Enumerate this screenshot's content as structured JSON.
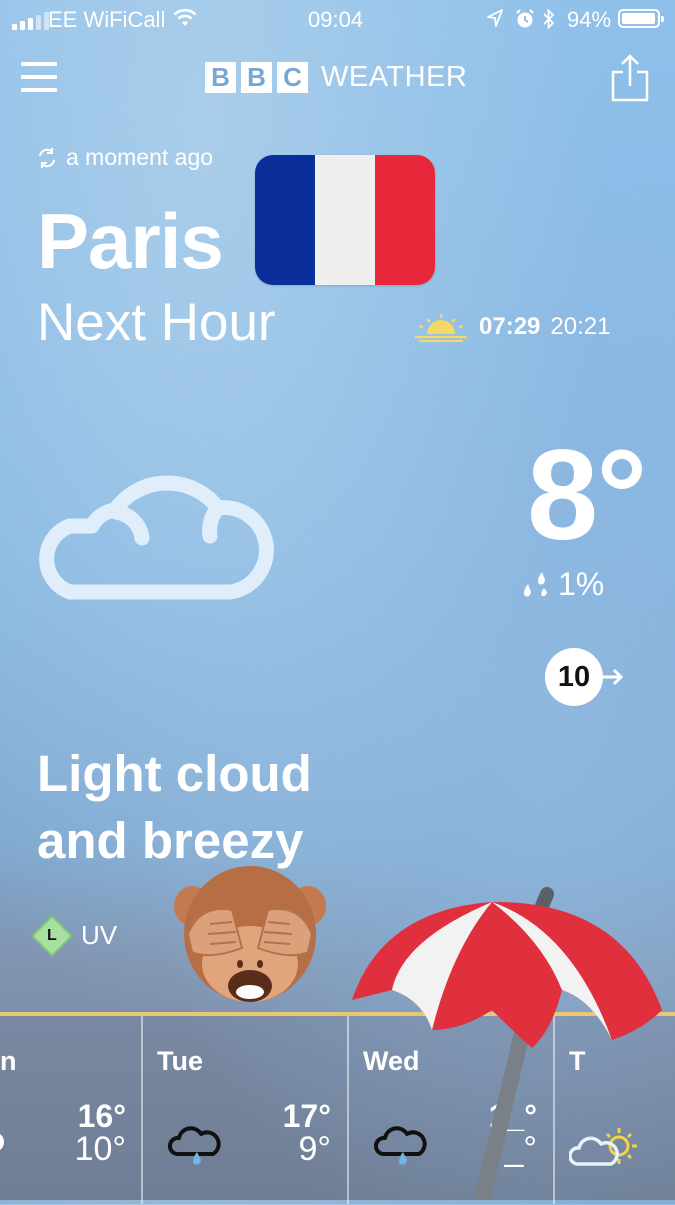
{
  "status_bar": {
    "carrier": "EE WiFiCall",
    "time": "09:04",
    "battery": "94%"
  },
  "header": {
    "logo_letters": [
      "B",
      "B",
      "C"
    ],
    "logo_word": "WEATHER"
  },
  "location": {
    "updated": "a moment ago",
    "city": "Paris",
    "subtitle": "Next Hour",
    "sunrise": "07:29",
    "sunset": "20:21",
    "flag_colors": [
      "#0a2e9a",
      "#efefef",
      "#e8283a"
    ]
  },
  "current": {
    "temperature": "8°",
    "precip_chance": "1%",
    "wind_speed": "10",
    "description_line1": "Light cloud",
    "description_line2": "and breezy",
    "uv_level": "L",
    "uv_label": "UV"
  },
  "forecast": [
    {
      "day": "n",
      "high": "16°",
      "low": "10°",
      "icon": "rain-cloud-icon"
    },
    {
      "day": "Tue",
      "high": "17°",
      "low": "9°",
      "icon": "rain-cloud-icon"
    },
    {
      "day": "Wed",
      "high": "1_°",
      "low": "_°",
      "icon": "rain-cloud-icon"
    },
    {
      "day": "T",
      "high": "",
      "low": "",
      "icon": "sun-cloud-icon"
    }
  ],
  "colors": {
    "accent": "#e8c870",
    "uv_green": "#a8e0a0"
  }
}
